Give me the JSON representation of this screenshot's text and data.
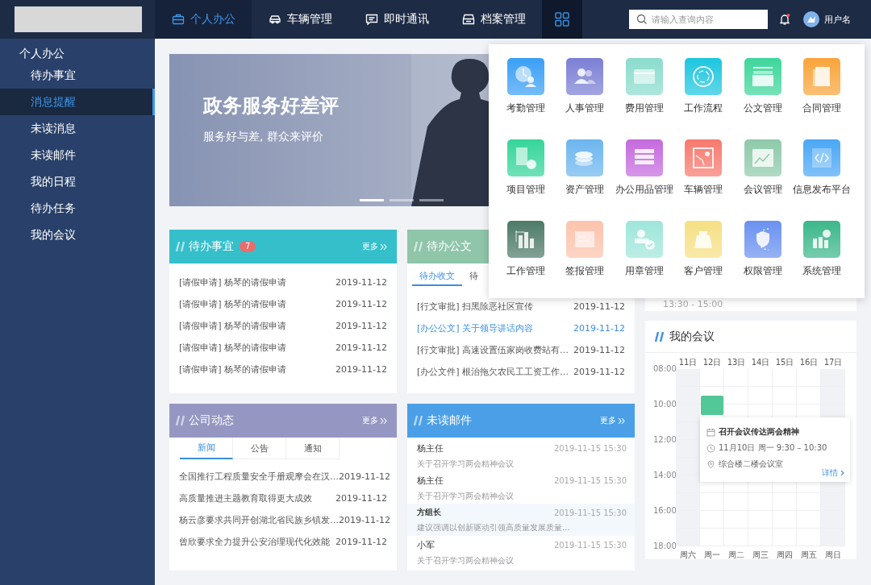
{
  "top_bar": {
    "nav": [
      {
        "label": "个人办公",
        "kind": "briefcase",
        "selected": true
      },
      {
        "label": "车辆管理",
        "kind": "car",
        "selected": false
      },
      {
        "label": "即时通讯",
        "kind": "chat",
        "selected": false
      },
      {
        "label": "档案管理",
        "kind": "archive",
        "selected": false
      }
    ],
    "apps_button": {
      "selected": true
    },
    "search": {
      "placeholder": "请输入查询内容"
    },
    "notification": {
      "unread": true
    },
    "user": {
      "name": "用户名"
    }
  },
  "sidebar": {
    "title": "个人办公",
    "items": [
      {
        "label": "待办事宜",
        "selected": false
      },
      {
        "label": "消息提醒",
        "selected": true
      },
      {
        "label": "未读消息",
        "selected": false
      },
      {
        "label": "未读邮件",
        "selected": false
      },
      {
        "label": "我的日程",
        "selected": false
      },
      {
        "label": "待办任务",
        "selected": false
      },
      {
        "label": "我的会议",
        "selected": false
      }
    ]
  },
  "banner": {
    "title": "政务服务好差评",
    "subtitle": "服务好与差, 群众来评价",
    "slides": [
      {
        "selected": true
      },
      {
        "selected": false
      },
      {
        "selected": false
      }
    ]
  },
  "todo_card": {
    "title": "待办事宜",
    "badge": "7",
    "more": "更多",
    "color": "#35bfcb",
    "rows": [
      {
        "text": "[请假申请] 杨琴的请假申请",
        "date": "2019-11-12"
      },
      {
        "text": "[请假申请] 杨琴的请假申请",
        "date": "2019-11-12"
      },
      {
        "text": "[请假申请] 杨琴的请假申请",
        "date": "2019-11-12"
      },
      {
        "text": "[请假申请] 杨琴的请假申请",
        "date": "2019-11-12"
      },
      {
        "text": "[请假申请] 杨琴的请假申请",
        "date": "2019-11-12"
      }
    ]
  },
  "docs_card": {
    "title": "待办公文",
    "color": "#8fc5a9",
    "tabs": [
      {
        "label": "待办收文",
        "selected": true
      },
      {
        "label": "待",
        "selected": false
      }
    ],
    "rows": [
      {
        "text": "[行文审批] 扫黑除恶社区宣传",
        "date": "2019-11-12",
        "selected": false
      },
      {
        "text": "[办公公文] 关于领导讲话内容",
        "date": "2019-11-12",
        "selected": true
      },
      {
        "text": "[行文审批] 高速设置伍家岗收费站有…",
        "date": "2019-11-12",
        "selected": false
      },
      {
        "text": "[办公文件] 根治拖欠农民工工资工作…",
        "date": "2019-11-12",
        "selected": false
      }
    ]
  },
  "news_card": {
    "title": "公司动态",
    "more": "更多",
    "color": "#9597c2",
    "tabs": [
      {
        "label": "新闻",
        "selected": true
      },
      {
        "label": "公告",
        "selected": false
      },
      {
        "label": "通知",
        "selected": false
      }
    ],
    "rows": [
      {
        "text": "全国推行工程质量安全手册观摩会在汉…",
        "date": "2019-11-12"
      },
      {
        "text": "高质量推进主题教育取得更大成效",
        "date": "2019-11-12"
      },
      {
        "text": "杨云彦要求共同开创湖北省民族乡镇发…",
        "date": "2019-11-12"
      },
      {
        "text": "曾欣要求全力提升公安治理现代化效能",
        "date": "2019-11-12"
      }
    ]
  },
  "mail_card": {
    "title": "未读邮件",
    "more": "更多",
    "color": "#4a9fe6",
    "items": [
      {
        "sender": "杨主任",
        "time": "2019-11-15 15:30",
        "preview": "关于召开学习两会精神会议",
        "selected": false
      },
      {
        "sender": "杨主任",
        "time": "2019-11-15 15:30",
        "preview": "关于召开学习两会精神会议",
        "selected": false
      },
      {
        "sender": "方组长",
        "time": "2019-11-15 15:30",
        "preview": "建议强调以创新驱动引领高质量发展质量…",
        "selected": true
      },
      {
        "sender": "小军",
        "time": "2019-11-15 15:30",
        "preview": "关于召开学习两会精神会议",
        "selected": false
      }
    ]
  },
  "schedule_card": {
    "time_range": "13:30 - 15:00"
  },
  "meetings_card": {
    "title": "我的会议",
    "hours": [
      "08:00",
      "10:00",
      "12:00",
      "14:00",
      "16:00",
      "18:00"
    ],
    "days": [
      {
        "label": "11日",
        "weekday": "周六",
        "weekend": true
      },
      {
        "label": "12日",
        "weekday": "周一",
        "weekend": false,
        "event": true
      },
      {
        "label": "13日",
        "weekday": "周二",
        "weekend": false
      },
      {
        "label": "14日",
        "weekday": "周三",
        "weekend": false
      },
      {
        "label": "15日",
        "weekday": "周四",
        "weekend": false
      },
      {
        "label": "16日",
        "weekday": "周五",
        "weekend": false
      },
      {
        "label": "17日",
        "weekday": "周日",
        "weekend": true
      }
    ],
    "popup": {
      "title": "召开会议传达两会精神",
      "time": "11月10日 周一 9:30 – 10:30",
      "place": "综合楼二楼会议室",
      "link": "详情"
    }
  },
  "apps_menu": {
    "apps": [
      {
        "label": "考勤管理",
        "kind": "clock",
        "color": "#3a9ff5"
      },
      {
        "label": "人事管理",
        "kind": "people",
        "color": "#7b7fd4"
      },
      {
        "label": "费用管理",
        "kind": "card",
        "color": "#8bdccd"
      },
      {
        "label": "工作流程",
        "kind": "ring",
        "color": "#1cc6df"
      },
      {
        "label": "公文管理",
        "kind": "tray",
        "color": "#3dd69a"
      },
      {
        "label": "合同管理",
        "kind": "document",
        "color": "#f9a43a"
      },
      {
        "label": "项目管理",
        "kind": "shapes",
        "color": "#35d59a"
      },
      {
        "label": "资产管理",
        "kind": "stack",
        "color": "#6cb6ef"
      },
      {
        "label": "办公用品管理",
        "kind": "list",
        "color": "#c56ade"
      },
      {
        "label": "车辆管理",
        "kind": "map",
        "color": "#f7796e"
      },
      {
        "label": "会议管理",
        "kind": "chart",
        "color": "#8ec9a9"
      },
      {
        "label": "信息发布平台",
        "kind": "code",
        "color": "#4aa7f5"
      },
      {
        "label": "工作管理",
        "kind": "bars",
        "color": "#4d7a68"
      },
      {
        "label": "签报管理",
        "kind": "form",
        "color": "#fcc3ad"
      },
      {
        "label": "用章管理",
        "kind": "stamp",
        "color": "#9fe6da"
      },
      {
        "label": "客户管理",
        "kind": "bag",
        "color": "#f6e084"
      },
      {
        "label": "权限管理",
        "kind": "shield",
        "color": "#6a91f0"
      },
      {
        "label": "系统管理",
        "kind": "gear",
        "color": "#3bb78a"
      }
    ]
  }
}
